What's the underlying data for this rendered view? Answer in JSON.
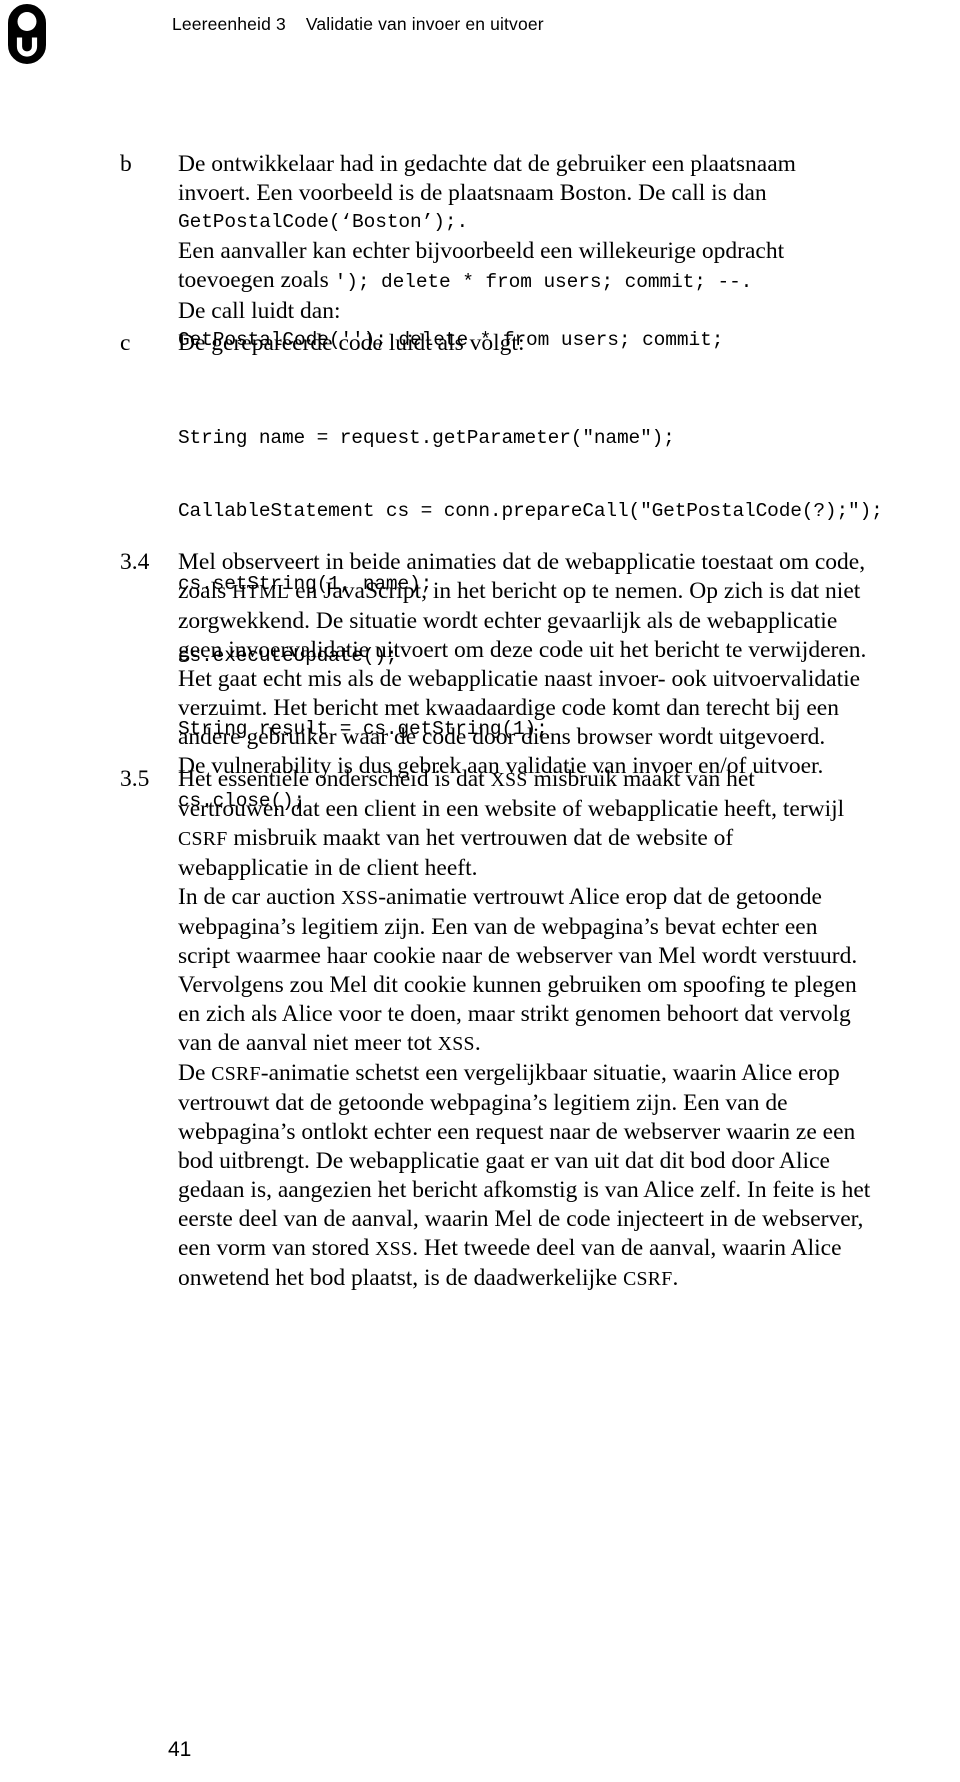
{
  "header": {
    "logo_alt": "Open Universiteit logo",
    "running_title": "Leereenheid 3    Validatie van invoer en uitvoer"
  },
  "content": {
    "item_b": {
      "marker": "b",
      "lines": [
        "De ontwikkelaar had in gedachte dat de gebruiker een plaatsnaam",
        "invoert. Een voorbeeld is de plaatsnaam Boston. De call is dan",
        "Een aanvaller kan echter bijvoorbeeld een willekeurige opdracht",
        "De call luidt dan:"
      ],
      "code_inline_1": "GetPostalCode(‘Boston’);.",
      "line_toevoegen_prefix": "toevoegen zoals ",
      "code_inline_2": "'); delete * from users; commit; --.",
      "code_inline_3": "GetPostalCode(''); delete * from users; commit;"
    },
    "item_c": {
      "marker": "c",
      "text": "De gerepareerde code luidt als volgt:"
    },
    "code_block": {
      "lines": [
        "String name = request.getParameter(\"name\");",
        "CallableStatement cs = conn.prepareCall(\"GetPostalCode(?);\");",
        "cs.setString(1, name);",
        "cs.executeUpdate();",
        "String result = cs.getString(1);",
        "cs.close();"
      ]
    },
    "item_3_4": {
      "marker": "3.4",
      "line_1_a": "Mel observeert in beide animaties dat de webapplicatie toestaat om code,",
      "line_2_a": "zoals ",
      "line_2_sc1": "HTML",
      "line_2_b": " en JavaScript, in het bericht op te nemen. Op zich is dat niet",
      "lines_rest": [
        "zorgwekkend. De situatie wordt echter gevaarlijk als de webapplicatie",
        "geen invoervalidatie uitvoert om deze code uit het bericht te verwijderen.",
        "Het gaat echt mis als de webapplicatie naast invoer- ook uitvoervalidatie",
        "verzuimt. Het bericht met kwaadaardige code komt dan terecht bij een",
        "andere gebruiker waar de code door diens browser wordt uitgevoerd.",
        "De vulnerability is dus gebrek aan validatie van invoer en/of uitvoer."
      ]
    },
    "item_3_5": {
      "marker": "3.5",
      "l1_a": "Het essentiële onderscheid is dat ",
      "l1_sc": "XSS",
      "l1_b": " misbruik maakt van het",
      "l2": "vertrouwen dat een client in een website of webapplicatie heeft, terwijl",
      "l3_sc": "CSRF",
      "l3_b": " misbruik maakt van het vertrouwen dat de website of",
      "l4": "webapplicatie in de client heeft.",
      "l5_a": "In de car auction ",
      "l5_sc": "XSS",
      "l5_b": "-animatie vertrouwt Alice erop dat de getoonde",
      "l6": "webpagina’s legitiem zijn. Een van de webpagina’s bevat echter een",
      "l7": "script waarmee haar cookie naar de webserver van Mel wordt verstuurd.",
      "l8": "Vervolgens zou Mel dit cookie kunnen gebruiken om spoofing te plegen",
      "l9": "en zich als Alice voor te doen, maar strikt genomen behoort dat vervolg",
      "l10_a": "van de aanval niet meer tot ",
      "l10_sc": "XSS",
      "l10_b": ".",
      "l11_a": "De ",
      "l11_sc": "CSRF",
      "l11_b": "-animatie schetst een vergelijkbaar situatie, waarin Alice erop",
      "l12": "vertrouwt dat de getoonde webpagina’s legitiem zijn. Een van de",
      "l13": "webpagina’s ontlokt echter een request naar de webserver waarin ze een",
      "l14": "bod uitbrengt. De webapplicatie gaat er van uit dat dit bod door Alice",
      "l15": "gedaan is, aangezien het bericht afkomstig is van Alice zelf. In feite is het",
      "l16": "eerste deel van de aanval, waarin Mel de code injecteert in de webserver,",
      "l17_a": "een vorm van stored ",
      "l17_sc": "XSS",
      "l17_b": ". Het tweede deel van de aanval, waarin Alice",
      "l18_a": "onwetend het bod plaatst, is de daadwerkelijke ",
      "l18_sc": "CSRF",
      "l18_b": "."
    }
  },
  "footer": {
    "page_number": "41"
  }
}
